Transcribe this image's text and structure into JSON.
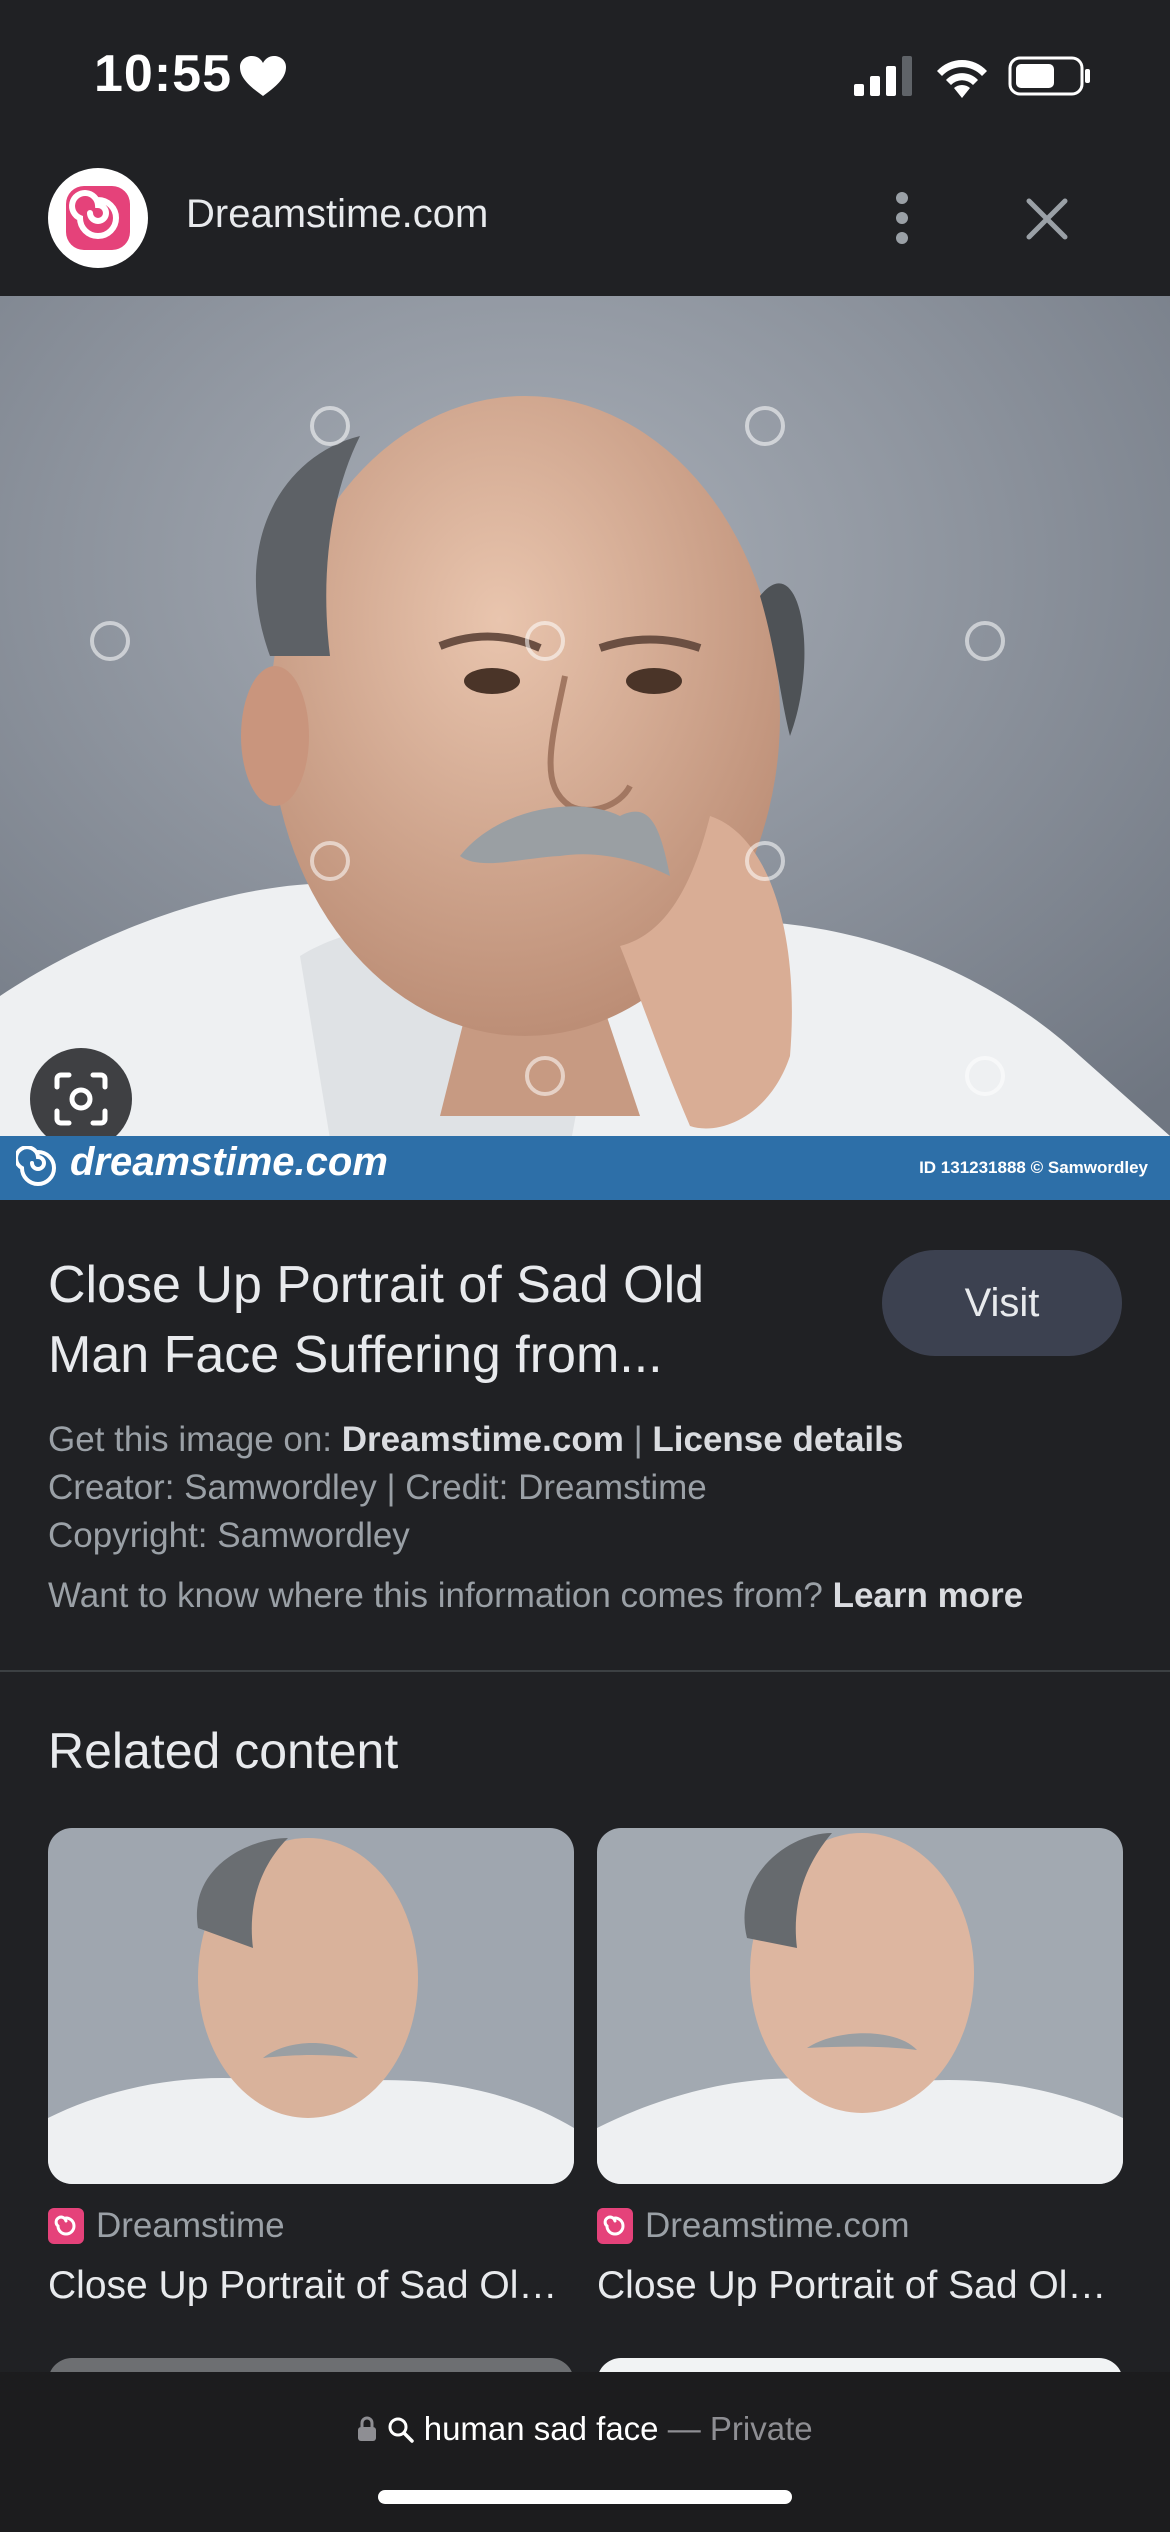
{
  "status_bar": {
    "time": "10:55"
  },
  "header": {
    "site_name": "Dreamstime.com"
  },
  "hero": {
    "banner_brand": "dreamstime.com",
    "banner_id": "ID 131231888 © Samwordley"
  },
  "result": {
    "title": "Close Up Portrait of Sad Old Man Face Suffering from...",
    "visit_label": "Visit",
    "get_image_prefix": "Get this image on: ",
    "get_image_source": "Dreamstime.com",
    "separator": " | ",
    "license_link": "License details",
    "creator_line": "Creator: Samwordley | Credit: Dreamstime",
    "copyright_line": "Copyright: Samwordley",
    "info_question": "Want to know where this information comes from? ",
    "learn_more": "Learn more"
  },
  "related": {
    "heading": "Related content",
    "items": [
      {
        "source": "Dreamstime",
        "title": "Close Up Portrait of Sad Old Man"
      },
      {
        "source": "Dreamstime.com",
        "title": "Close Up Portrait of Sad Old Man"
      }
    ]
  },
  "bottom_bar": {
    "query": "human sad face",
    "dash": " — ",
    "mode": "Private"
  },
  "colors": {
    "background": "#202124",
    "banner": "#2d6fa8",
    "brand_pink": "#e5427a",
    "visit_button": "#3c4150"
  }
}
